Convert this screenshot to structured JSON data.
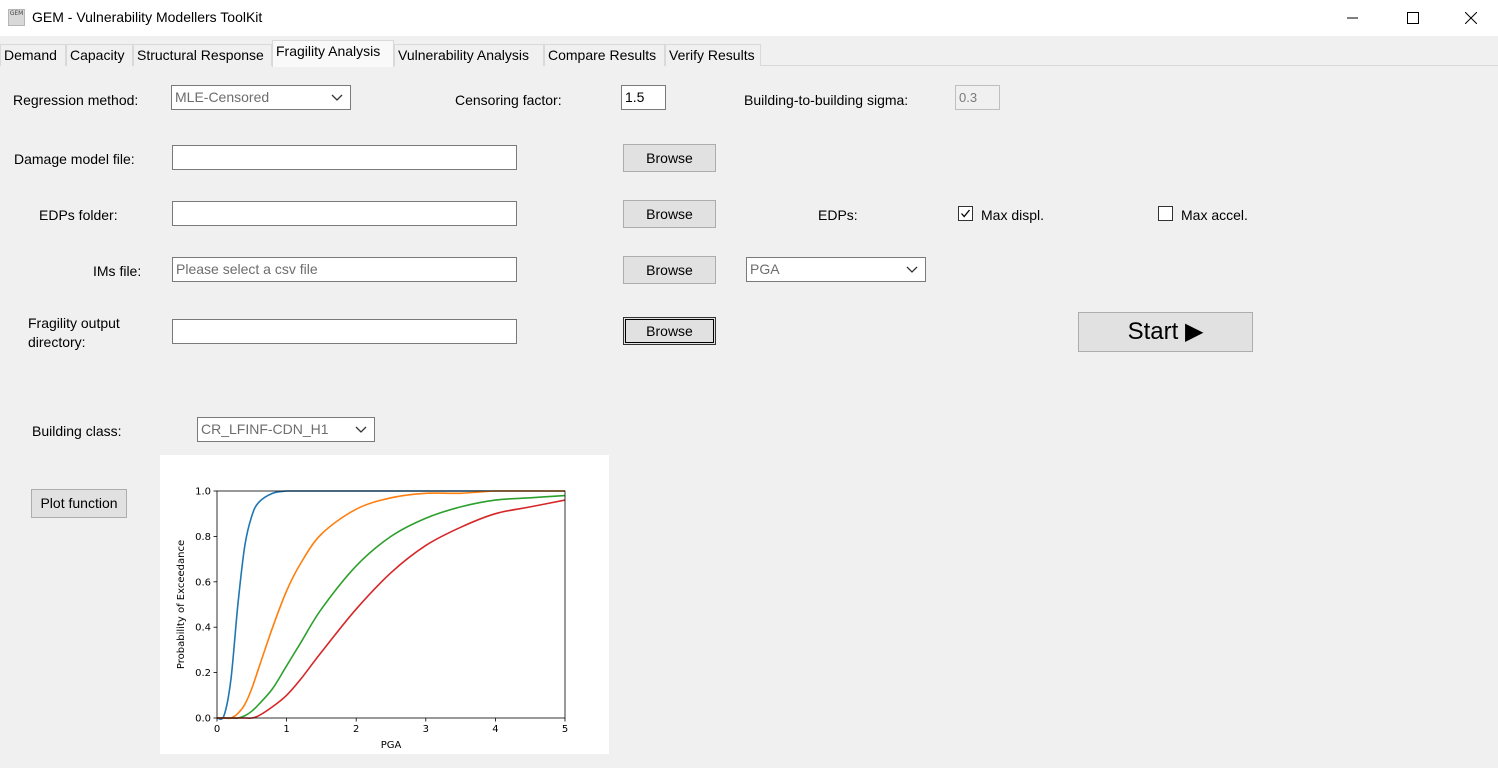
{
  "window": {
    "title": "GEM - Vulnerability Modellers ToolKit",
    "icon_label": "GEM"
  },
  "tabs": [
    {
      "label": "Demand",
      "active": false
    },
    {
      "label": "Capacity",
      "active": false
    },
    {
      "label": "Structural Response",
      "active": false
    },
    {
      "label": "Fragility Analysis",
      "active": true
    },
    {
      "label": "Vulnerability Analysis",
      "active": false
    },
    {
      "label": "Compare Results",
      "active": false
    },
    {
      "label": "Verify Results",
      "active": false
    }
  ],
  "form": {
    "regression_label": "Regression method:",
    "regression_value": "MLE-Censored",
    "censoring_label": "Censoring factor:",
    "censoring_value": "1.5",
    "sigma_label": "Building-to-building sigma:",
    "sigma_value": "0.3",
    "damage_label": "Damage model file:",
    "damage_value": "",
    "edps_folder_label": "EDPs folder:",
    "edps_folder_value": "",
    "ims_label": "IMs file:",
    "ims_placeholder": "Please select a csv file",
    "output_label_line1": "Fragility output",
    "output_label_line2": "directory:",
    "output_value": "",
    "browse_label": "Browse",
    "im_select_value": "PGA",
    "edps_label": "EDPs:",
    "max_displ_label": "Max displ.",
    "max_displ_checked": true,
    "max_accel_label": "Max accel.",
    "max_accel_checked": false,
    "start_label": "Start ▶",
    "building_class_label": "Building class:",
    "building_class_value": "CR_LFINF-CDN_H1",
    "plot_button_label": "Plot function"
  },
  "chart_data": {
    "type": "line",
    "title": "",
    "xlabel": "PGA",
    "ylabel": "Probability of Exceedance",
    "xlim": [
      0,
      5
    ],
    "ylim": [
      0,
      1
    ],
    "xticks": [
      "0",
      "1",
      "2",
      "3",
      "4",
      "5"
    ],
    "yticks": [
      "0.0",
      "0.2",
      "0.4",
      "0.6",
      "0.8",
      "1.0"
    ],
    "grid": false,
    "legend": "none",
    "x": [
      0,
      0.1,
      0.2,
      0.3,
      0.4,
      0.5,
      0.6,
      0.8,
      1.0,
      1.2,
      1.5,
      2.0,
      2.5,
      3.0,
      3.5,
      4.0,
      4.5,
      5.0
    ],
    "series": [
      {
        "color": "#1f77b4",
        "values": [
          0.0,
          0.01,
          0.17,
          0.5,
          0.76,
          0.89,
          0.95,
          0.99,
          1.0,
          1.0,
          1.0,
          1.0,
          1.0,
          1.0,
          1.0,
          1.0,
          1.0,
          1.0
        ]
      },
      {
        "color": "#ff7f0e",
        "values": [
          0.0,
          0.0,
          0.0,
          0.02,
          0.06,
          0.13,
          0.22,
          0.4,
          0.56,
          0.68,
          0.81,
          0.92,
          0.97,
          0.99,
          0.99,
          1.0,
          1.0,
          1.0
        ]
      },
      {
        "color": "#2ca02c",
        "values": [
          0.0,
          0.0,
          0.0,
          0.0,
          0.01,
          0.03,
          0.06,
          0.13,
          0.23,
          0.33,
          0.48,
          0.67,
          0.8,
          0.88,
          0.93,
          0.96,
          0.97,
          0.98
        ]
      },
      {
        "color": "#d62728",
        "values": [
          0.0,
          0.0,
          0.0,
          0.0,
          0.0,
          0.0,
          0.01,
          0.05,
          0.1,
          0.17,
          0.29,
          0.48,
          0.64,
          0.76,
          0.84,
          0.9,
          0.93,
          0.96
        ]
      }
    ]
  }
}
